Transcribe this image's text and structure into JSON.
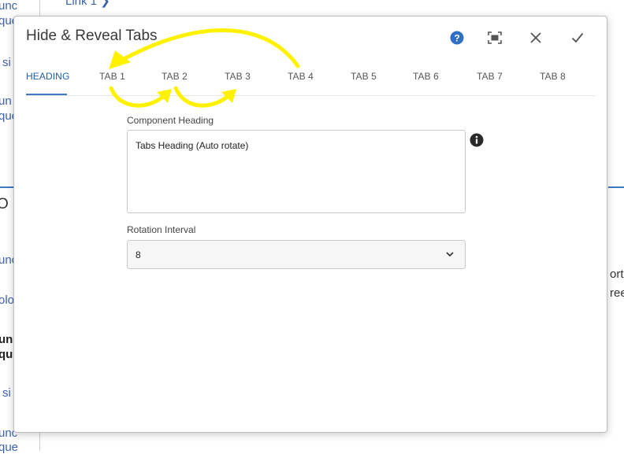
{
  "background": {
    "top_link": "Link 1",
    "left_fragments": [
      "unc",
      "que",
      "si",
      "un",
      "que",
      "O",
      "unc",
      "olo",
      "un",
      "que",
      "si",
      "unc",
      "que"
    ],
    "right_fragments": [
      "ort",
      "ree"
    ]
  },
  "dialog": {
    "title": "Hide & Reveal Tabs",
    "header_icons": [
      "help-icon",
      "fullscreen-icon",
      "close-icon",
      "checkmark-icon"
    ],
    "tabs": [
      {
        "label": "HEADING",
        "active": true
      },
      {
        "label": "TAB 1"
      },
      {
        "label": "TAB 2"
      },
      {
        "label": "TAB 3"
      },
      {
        "label": "TAB 4"
      },
      {
        "label": "TAB 5"
      },
      {
        "label": "TAB 6"
      },
      {
        "label": "TAB 7"
      },
      {
        "label": "TAB 8"
      }
    ],
    "component_heading": {
      "label": "Component Heading",
      "value": "Tabs Heading (Auto rotate)"
    },
    "rotation_interval": {
      "label": "Rotation Interval",
      "value": "8"
    }
  },
  "colors": {
    "accent": "#3e79c3",
    "help_blue": "#2f6fc4",
    "annotation_yellow": "#fff200"
  }
}
